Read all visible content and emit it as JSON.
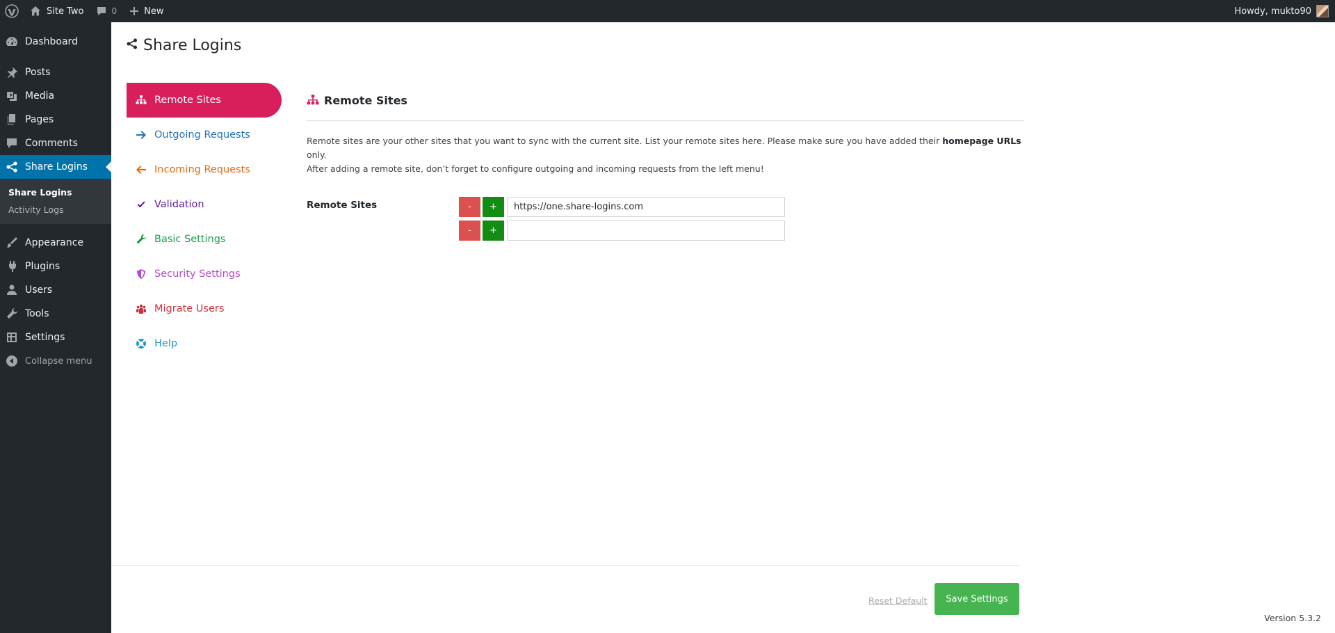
{
  "adminbar": {
    "site_name": "Site Two",
    "comments_count": "0",
    "new_label": "New",
    "howdy": "Howdy, mukto90"
  },
  "menu": {
    "dashboard": "Dashboard",
    "posts": "Posts",
    "media": "Media",
    "pages": "Pages",
    "comments": "Comments",
    "share_logins": "Share Logins",
    "submenu": [
      "Share Logins",
      "Activity Logs"
    ],
    "appearance": "Appearance",
    "plugins": "Plugins",
    "users": "Users",
    "tools": "Tools",
    "settings": "Settings",
    "collapse": "Collapse menu"
  },
  "page": {
    "title": "Share Logins"
  },
  "plugin_nav": [
    {
      "label": "Remote Sites",
      "icon": "sitemap-icon",
      "color": "#d81e5b"
    },
    {
      "label": "Outgoing Requests",
      "icon": "arrow-right-icon",
      "color": "#1e73be"
    },
    {
      "label": "Incoming Requests",
      "icon": "arrow-left-icon",
      "color": "#e66a0d"
    },
    {
      "label": "Validation",
      "icon": "check-icon",
      "color": "#5b1e9b"
    },
    {
      "label": "Basic Settings",
      "icon": "wrench-icon",
      "color": "#1a9c4a"
    },
    {
      "label": "Security Settings",
      "icon": "shield-icon",
      "color": "#b54bcf"
    },
    {
      "label": "Migrate Users",
      "icon": "users-icon",
      "color": "#d0303a"
    },
    {
      "label": "Help",
      "icon": "lifebuoy-icon",
      "color": "#1e9ad6"
    }
  ],
  "section": {
    "title": "Remote Sites",
    "desc_part1": "Remote sites are your other sites that you want to sync with the current site. List your remote sites here. Please make sure you have added their ",
    "desc_bold": "homepage URLs",
    "desc_part2": " only.",
    "desc_line2": "After adding a remote site, don’t forget to configure outgoing and incoming requests from the left menu!",
    "field_label": "Remote Sites",
    "minus_label": "-",
    "plus_label": "+",
    "rows": [
      {
        "value": "https://one.share-logins.com"
      },
      {
        "value": ""
      }
    ]
  },
  "actions": {
    "reset": "Reset Default",
    "save": "Save Settings"
  },
  "footer": {
    "version": "Version 5.3.2"
  },
  "colors": {
    "admin_dark": "#23282d",
    "admin_blue": "#0073aa",
    "accent": "#d81e5b",
    "save_green": "#46b450"
  }
}
